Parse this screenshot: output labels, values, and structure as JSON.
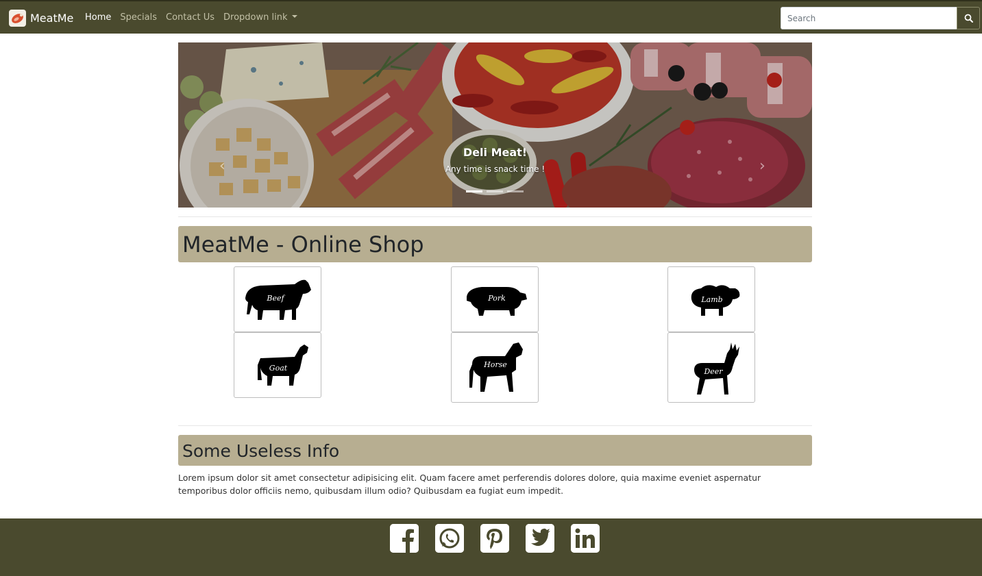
{
  "navbar": {
    "brand": "MeatMe",
    "links": [
      {
        "label": "Home",
        "active": true
      },
      {
        "label": "Specials",
        "active": false
      },
      {
        "label": "Contact Us",
        "active": false
      },
      {
        "label": "Dropdown link",
        "active": false
      }
    ],
    "search_placeholder": "Search",
    "search_icon": "search-icon",
    "colors": {
      "bar": "#4a4a2e",
      "active_link": "#ffffff",
      "link": "#c2c0a6"
    }
  },
  "carousel": {
    "title": "Deli Meat!",
    "text": "Any time is snack time !",
    "prev_icon": "chevron-left-icon",
    "next_icon": "chevron-right-icon",
    "slide_count": 3,
    "active_slide": 1
  },
  "shop": {
    "heading": "MeatMe - Online Shop",
    "heading_color": "#b7ae91",
    "categories": [
      {
        "label": "Beef",
        "icon": "cow-icon"
      },
      {
        "label": "Pork",
        "icon": "pig-icon"
      },
      {
        "label": "Lamb",
        "icon": "sheep-icon"
      },
      {
        "label": "Goat",
        "icon": "goat-icon"
      },
      {
        "label": "Horse",
        "icon": "horse-icon"
      },
      {
        "label": "Deer",
        "icon": "deer-icon"
      }
    ]
  },
  "info": {
    "heading": "Some Useless Info",
    "body": "Lorem ipsum dolor sit amet consectetur adipisicing elit. Quam facere amet perferendis dolores dolore, quia maxime eveniet aspernatur temporibus dolor officiis nemo, quibusdam illum odio? Quibusdam ea fugiat eum impedit."
  },
  "footer": {
    "social": [
      {
        "name": "facebook",
        "icon": "facebook-icon"
      },
      {
        "name": "whatsapp",
        "icon": "whatsapp-icon"
      },
      {
        "name": "pinterest",
        "icon": "pinterest-icon"
      },
      {
        "name": "twitter",
        "icon": "twitter-icon"
      },
      {
        "name": "linkedin",
        "icon": "linkedin-icon"
      }
    ]
  }
}
